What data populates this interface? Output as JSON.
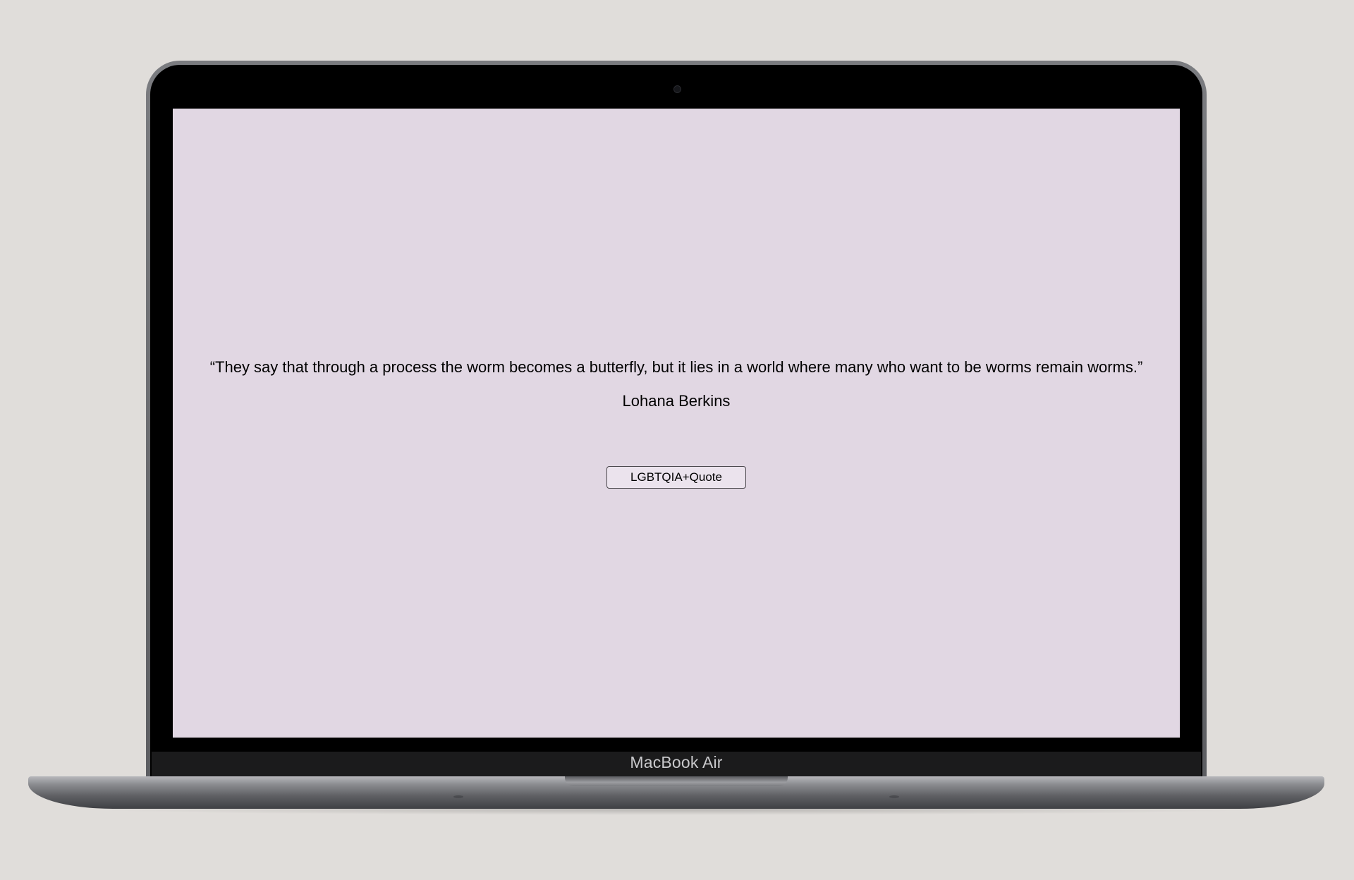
{
  "screen": {
    "background_color": "#e1d7e3",
    "quote": {
      "text": "“They say that through a process the worm becomes a butterfly, but it lies in a world where many who want to be worms remain worms.”",
      "author": "Lohana Berkins"
    },
    "button": {
      "label": "LGBTQIA+Quote"
    }
  },
  "device": {
    "brand_label": "MacBook Air"
  },
  "colors": {
    "page_background": "#e0ddda",
    "bezel": "#000000",
    "text": "#000000"
  }
}
